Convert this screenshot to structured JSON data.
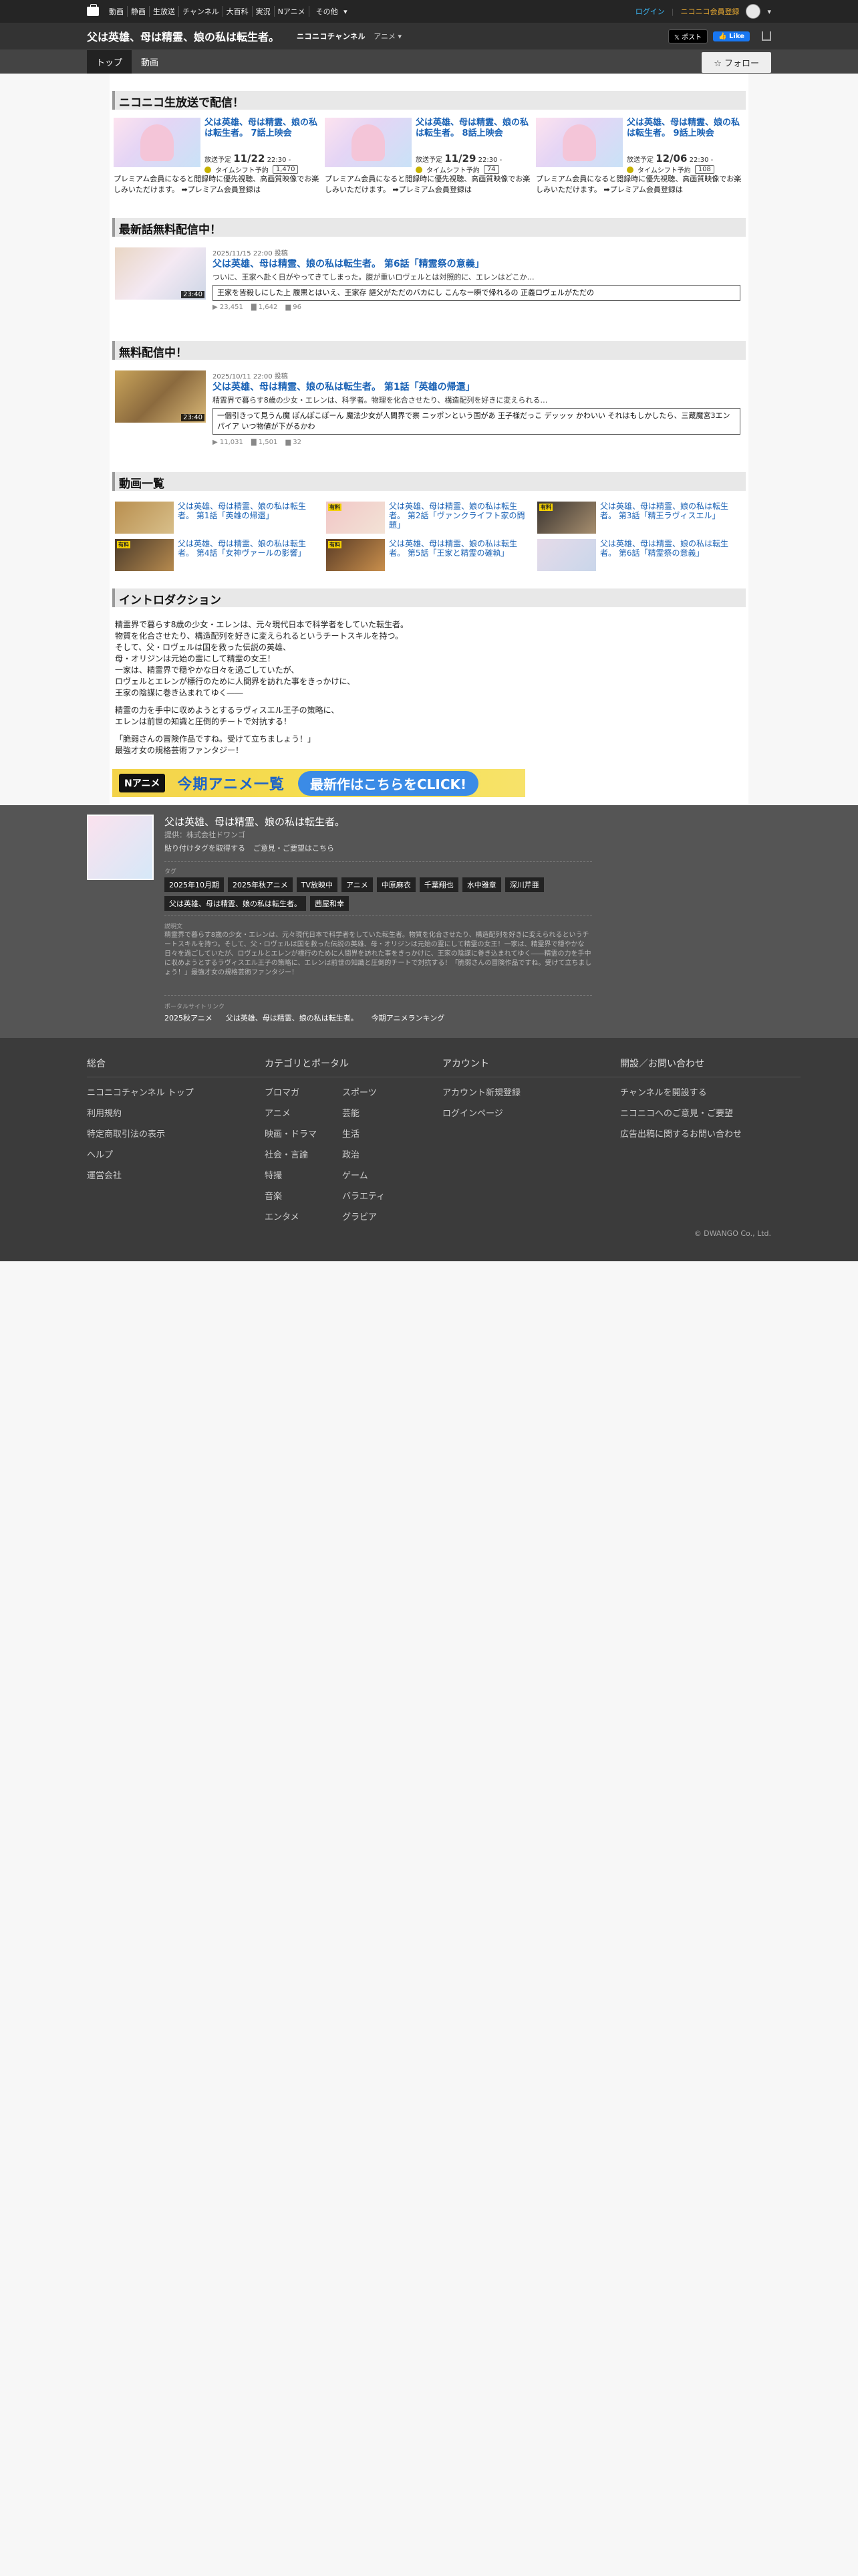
{
  "globalbar": {
    "nav": [
      "動画",
      "静画",
      "生放送",
      "チャンネル",
      "大百科",
      "実況",
      "Nアニメ",
      "その他"
    ],
    "login": "ログイン",
    "premium": "ニコニコ会員登録"
  },
  "channel": {
    "title": "父は英雄、母は精霊、娘の私は転生者。",
    "brand": "ニコニコチャンネル",
    "category": "アニメ",
    "post_label": "ポスト",
    "like_label": "Like",
    "follow_label": "フォロー",
    "tabs": [
      "トップ",
      "動画"
    ]
  },
  "sections": {
    "live": "ニコニコ生放送で配信！",
    "latest": "最新話無料配信中！",
    "free": "無料配信中！",
    "list": "動画一覧",
    "intro": "イントロダクション"
  },
  "live_cards": [
    {
      "title": "父は英雄、母は精霊、娘の私は転生者。 7話上映会",
      "date_prefix": "放送予定",
      "date": "11/22",
      "time": "22:30 -",
      "ts_label": "タイムシフト予約",
      "count": "1,470",
      "desc": "プレミアム会員になると閲録時に優先視聴、高画質映像でお楽しみいただけます。 ➡プレミアム会員登録は"
    },
    {
      "title": "父は英雄、母は精霊、娘の私は転生者。 8話上映会",
      "date_prefix": "放送予定",
      "date": "11/29",
      "time": "22:30 -",
      "ts_label": "タイムシフト予約",
      "count": "74",
      "desc": "プレミアム会員になると閲録時に優先視聴、高画質映像でお楽しみいただけます。 ➡プレミアム会員登録は"
    },
    {
      "title": "父は英雄、母は精霊、娘の私は転生者。 9話上映会",
      "date_prefix": "放送予定",
      "date": "12/06",
      "time": "22:30 -",
      "ts_label": "タイムシフト予約",
      "count": "108",
      "desc": "プレミアム会員になると閲録時に優先視聴、高画質映像でお楽しみいただけます。 ➡プレミアム会員登録は"
    }
  ],
  "latest": {
    "posted": "2025/11/15 22:00 投稿",
    "title": "父は英雄、母は精霊、娘の私は転生者。 第6話「精霊祭の意義」",
    "desc": "ついに、王家へ赴く日がやってきてしまった。腹が重いロヴェルとは対照的に、エレンはどこか…",
    "comments": "王家を皆殺しにした上 腹黒とはいえ、王家存 謳父がただのバカにし こんなー瞬で帰れるの 正義ロヴェルがただの",
    "duration": "23:40",
    "views": "23,451",
    "comments_count": "1,642",
    "mylist": "96"
  },
  "free": {
    "posted": "2025/10/11 22:00 投稿",
    "title": "父は英雄、母は精霊、娘の私は転生者。 第1話「英雄の帰還」",
    "desc": "精霊界で暮らす8歳の少女・エレンは、科学者。物理を化合させたり、構造配列を好きに変えられる…",
    "comments": "一個引きって見うん魔 ぽんぽこぽーん 魔法少女が人間界で察 ニッポンという国があ 王子様だっこ デッッッ かわいい それはもしかしたら、三蔵魔宮3エンパイア いつ物値が下がるかわ",
    "duration": "23:40",
    "views": "11,031",
    "comments_count": "1,501",
    "mylist": "32"
  },
  "list": [
    {
      "title": "父は英雄、母は精霊、娘の私は転生者。 第1話「英雄の帰還」",
      "badge": ""
    },
    {
      "title": "父は英雄、母は精霊、娘の私は転生者。 第2話「ヴァンクライフト家の問題」",
      "badge": "有料"
    },
    {
      "title": "父は英雄、母は精霊、娘の私は転生者。 第3話「精王ラヴィスエル」",
      "badge": "有料"
    },
    {
      "title": "父は英雄、母は精霊、娘の私は転生者。 第4話「女神ヴァールの影響」",
      "badge": "有料"
    },
    {
      "title": "父は英雄、母は精霊、娘の私は転生者。 第5話「王家と精霊の確執」",
      "badge": "有料"
    },
    {
      "title": "父は英雄、母は精霊、娘の私は転生者。 第6話「精霊祭の意義」",
      "badge": ""
    }
  ],
  "intro": [
    "精霊界で暮らす8歳の少女・エレンは、元々現代日本で科学者をしていた転生者。\n物質を化合させたり、構造配列を好きに変えられるというチートスキルを持つ。\nそして、父・ロヴェルは国を救った伝説の英雄、\n母・オリジンは元始の霊にして精霊の女王！\n一家は、精霊界で穏やかな日々を過ごしていたが、\nロヴェルとエレンが標行のために人間界を訪れた事をきっかけに、\n王家の陰謀に巻き込まれてゆく――",
    "精霊の力を手中に収めようとするラヴィスエル王子の策略に、\nエレンは前世の知識と圧倒的チートで対抗する！",
    "「脆弱さんの冒険作品ですね。受けて立ちましょう！」\n最強才女の規格芸術ファンタジー！"
  ],
  "banner": {
    "badge": "Nアニメ",
    "text": "今期アニメ一覧",
    "cta": "最新作はこちらをCLICK!"
  },
  "info": {
    "name": "父は英雄、母は精霊、娘の私は転生者。",
    "provider": "提供：株式会社ドワンゴ",
    "links": [
      "貼り付けタグを取得する",
      "ご意見・ご要望はこちら"
    ],
    "tags_label": "タグ",
    "tags": [
      "2025年10月期",
      "2025年秋アニメ",
      "TV放映中",
      "アニメ",
      "中原麻衣",
      "千葉翔也",
      "水中雅章",
      "深川芹亜",
      "父は英雄、母は精霊、娘の私は転生者。",
      "茜屋和幸"
    ],
    "about_label": "説明文",
    "about": "精霊界で暮らす8歳の少女・エレンは、元々現代日本で科学者をしていた転生者。物質を化合させたり、構造配列を好きに変えられるというチートスキルを持つ。そして、父・ロヴェルは国を救った伝説の英雄、母・オリジンは元始の霊にして精霊の女王！一家は、精霊界で穏やかな日々を過ごしていたが、ロヴェルとエレンが標行のために人間界を訪れた事をきっかけに、王家の陰謀に巻き込まれてゆく――精霊の力を手中に収めようとするラヴィスエル王子の策略に、エレンは前世の知識と圧倒的チートで対抗する！「脆弱さんの冒険作品ですね。受けて立ちましょう！」最強才女の規格芸術ファンタジー！",
    "portal_label": "ポータルサイトリンク",
    "portal": [
      "2025秋アニメ",
      "父は英雄、母は精霊、娘の私は転生者。",
      "今期アニメランキング"
    ]
  },
  "footer": {
    "col1_title": "総合",
    "col1": [
      "ニコニコチャンネル トップ",
      "利用規約",
      "特定商取引法の表示",
      "ヘルプ",
      "運営会社"
    ],
    "col2_title": "カテゴリとポータル",
    "col2": [
      "ブロマガ",
      "スポーツ",
      "アニメ",
      "芸能",
      "映画・ドラマ",
      "生活",
      "社会・言論",
      "政治",
      "特撮",
      "ゲーム",
      "音楽",
      "バラエティ",
      "エンタメ",
      "グラビア"
    ],
    "col3_title": "アカウント",
    "col3": [
      "アカウント新規登録",
      "ログインページ"
    ],
    "col4_title": "開設／お問い合わせ",
    "col4": [
      "チャンネルを開設する",
      "ニコニコへのご意見・ご要望",
      "広告出稿に関するお問い合わせ"
    ],
    "copyright": "© DWANGO Co., Ltd."
  },
  "colors": {
    "link": "#1a62b5",
    "badge": "#f4d000",
    "banner": "#f3d34a"
  }
}
